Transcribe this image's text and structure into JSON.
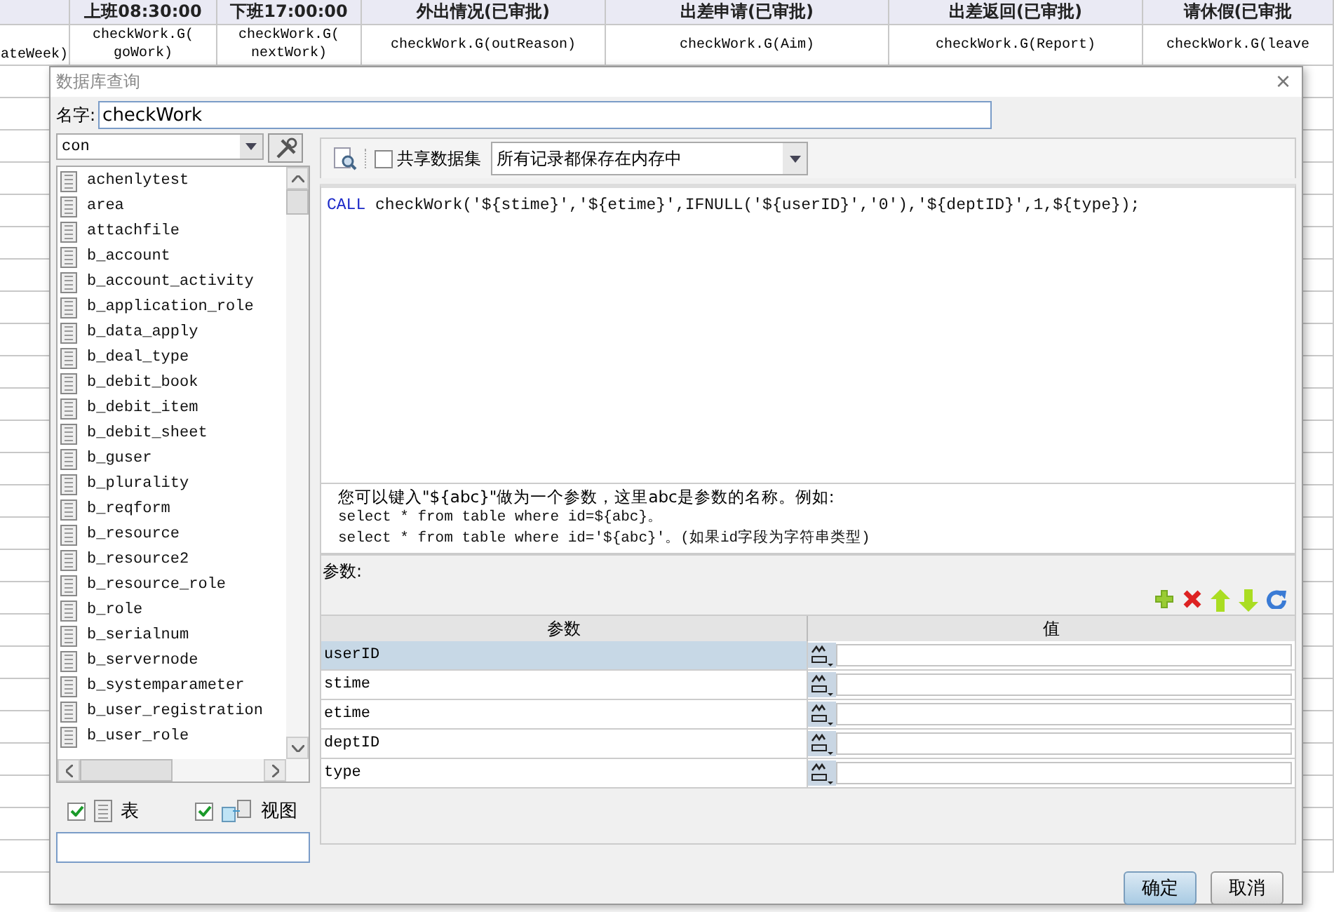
{
  "sheet": {
    "columns": [
      {
        "cell": [
          "ateWeek)"
        ]
      },
      {
        "header": "上班08:30:00",
        "cell": [
          "checkWork.G(",
          "goWork)"
        ]
      },
      {
        "header": "下班17:00:00",
        "cell": [
          "checkWork.G(",
          "nextWork)"
        ]
      },
      {
        "header": "外出情况(已审批)",
        "cell": [
          "checkWork.G(outReason)"
        ]
      },
      {
        "header": "出差申请(已审批)",
        "cell": [
          "checkWork.G(Aim)"
        ]
      },
      {
        "header": "出差返回(已审批)",
        "cell": [
          "checkWork.G(Report)"
        ]
      },
      {
        "header": "请休假(已审批",
        "cell": [
          "checkWork.G(leave"
        ]
      }
    ]
  },
  "dialog": {
    "title": "数据库查询",
    "close": "×",
    "name": {
      "label": "名字:",
      "value": "checkWork"
    },
    "filter": {
      "value": "con"
    },
    "tables": [
      {
        "name": "achenlytest"
      },
      {
        "name": "area"
      },
      {
        "name": "attachfile"
      },
      {
        "name": "b_account"
      },
      {
        "name": "b_account_activity"
      },
      {
        "name": "b_application_role"
      },
      {
        "name": "b_data_apply"
      },
      {
        "name": "b_deal_type"
      },
      {
        "name": "b_debit_book"
      },
      {
        "name": "b_debit_item"
      },
      {
        "name": "b_debit_sheet"
      },
      {
        "name": "b_guser"
      },
      {
        "name": "b_plurality"
      },
      {
        "name": "b_reqform"
      },
      {
        "name": "b_resource"
      },
      {
        "name": "b_resource2"
      },
      {
        "name": "b_resource_role"
      },
      {
        "name": "b_role"
      },
      {
        "name": "b_serialnum"
      },
      {
        "name": "b_servernode"
      },
      {
        "name": "b_systemparameter"
      },
      {
        "name": "b_user_registration"
      },
      {
        "name": "b_user_role"
      }
    ],
    "filters": [
      {
        "kind": "table",
        "label": "表",
        "checked": true
      },
      {
        "kind": "view",
        "label": "视图",
        "checked": true
      }
    ],
    "share": {
      "label": "共享数据集",
      "checked": false
    },
    "mode": {
      "value": "所有记录都保存在内存中"
    },
    "sql": {
      "keyword": "CALL",
      "text": " checkWork('${stime}','${etime}',IFNULL('${userID}','0'),'${deptID}',1,${type});"
    },
    "hint": [
      "您可以键入\"${abc}\"做为一个参数，这里abc是参数的名称。例如:",
      "select * from table where id=${abc}。",
      "select * from table where id='${abc}'。(如果id字段为字符串类型)"
    ],
    "params_label": "参数:",
    "param_columns": [
      "参数",
      "值"
    ],
    "params": [
      {
        "name": "userID",
        "selected": true
      },
      {
        "name": "stime",
        "selected": false
      },
      {
        "name": "etime",
        "selected": false
      },
      {
        "name": "deptID",
        "selected": false
      },
      {
        "name": "type",
        "selected": false
      }
    ],
    "buttons": [
      {
        "label": "确定",
        "primary": true
      },
      {
        "label": "取消",
        "primary": false
      }
    ]
  }
}
